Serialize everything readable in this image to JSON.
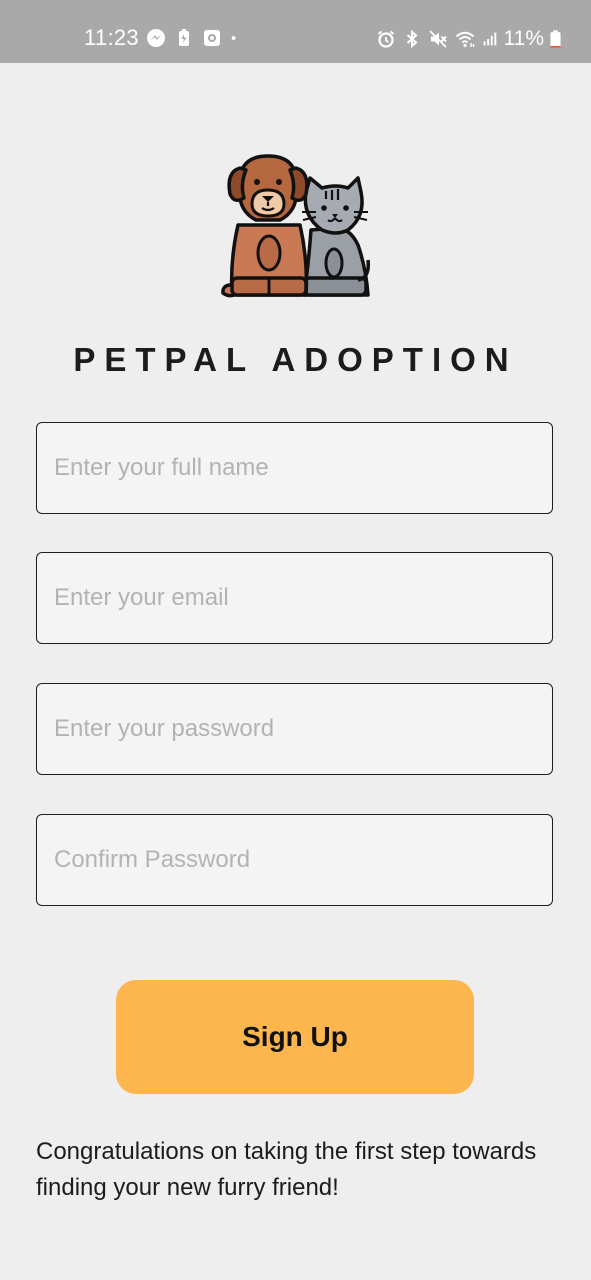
{
  "status_bar": {
    "time": "11:23",
    "battery": "11%",
    "left_icons": [
      "messenger-icon",
      "battery-saver-icon",
      "screen-record-icon",
      "dot-icon"
    ],
    "right_icons": [
      "alarm-icon",
      "bluetooth-icon",
      "mute-icon",
      "wifi-icon",
      "signal-icon",
      "battery-icon"
    ],
    "battery_level": 0.11,
    "battery_color": "#e8552f"
  },
  "logo": {
    "icon": "dog-and-cat-logo"
  },
  "app": {
    "title": "PETPAL ADOPTION"
  },
  "form": {
    "full_name": {
      "placeholder": "Enter your full name",
      "value": ""
    },
    "email": {
      "placeholder": "Enter your email",
      "value": ""
    },
    "password": {
      "placeholder": "Enter your password",
      "value": ""
    },
    "confirm_password": {
      "placeholder": "Confirm Password",
      "value": ""
    },
    "submit_label": "Sign Up"
  },
  "footer": {
    "message": "Congratulations on taking the first step towards finding your new furry friend!"
  },
  "colors": {
    "background": "#eeeeee",
    "status_bar": "#a9a9a9",
    "accent": "#fdb54e",
    "field_background": "#f4f4f4",
    "dog": "#c97a55",
    "cat": "#9aa0a6"
  }
}
